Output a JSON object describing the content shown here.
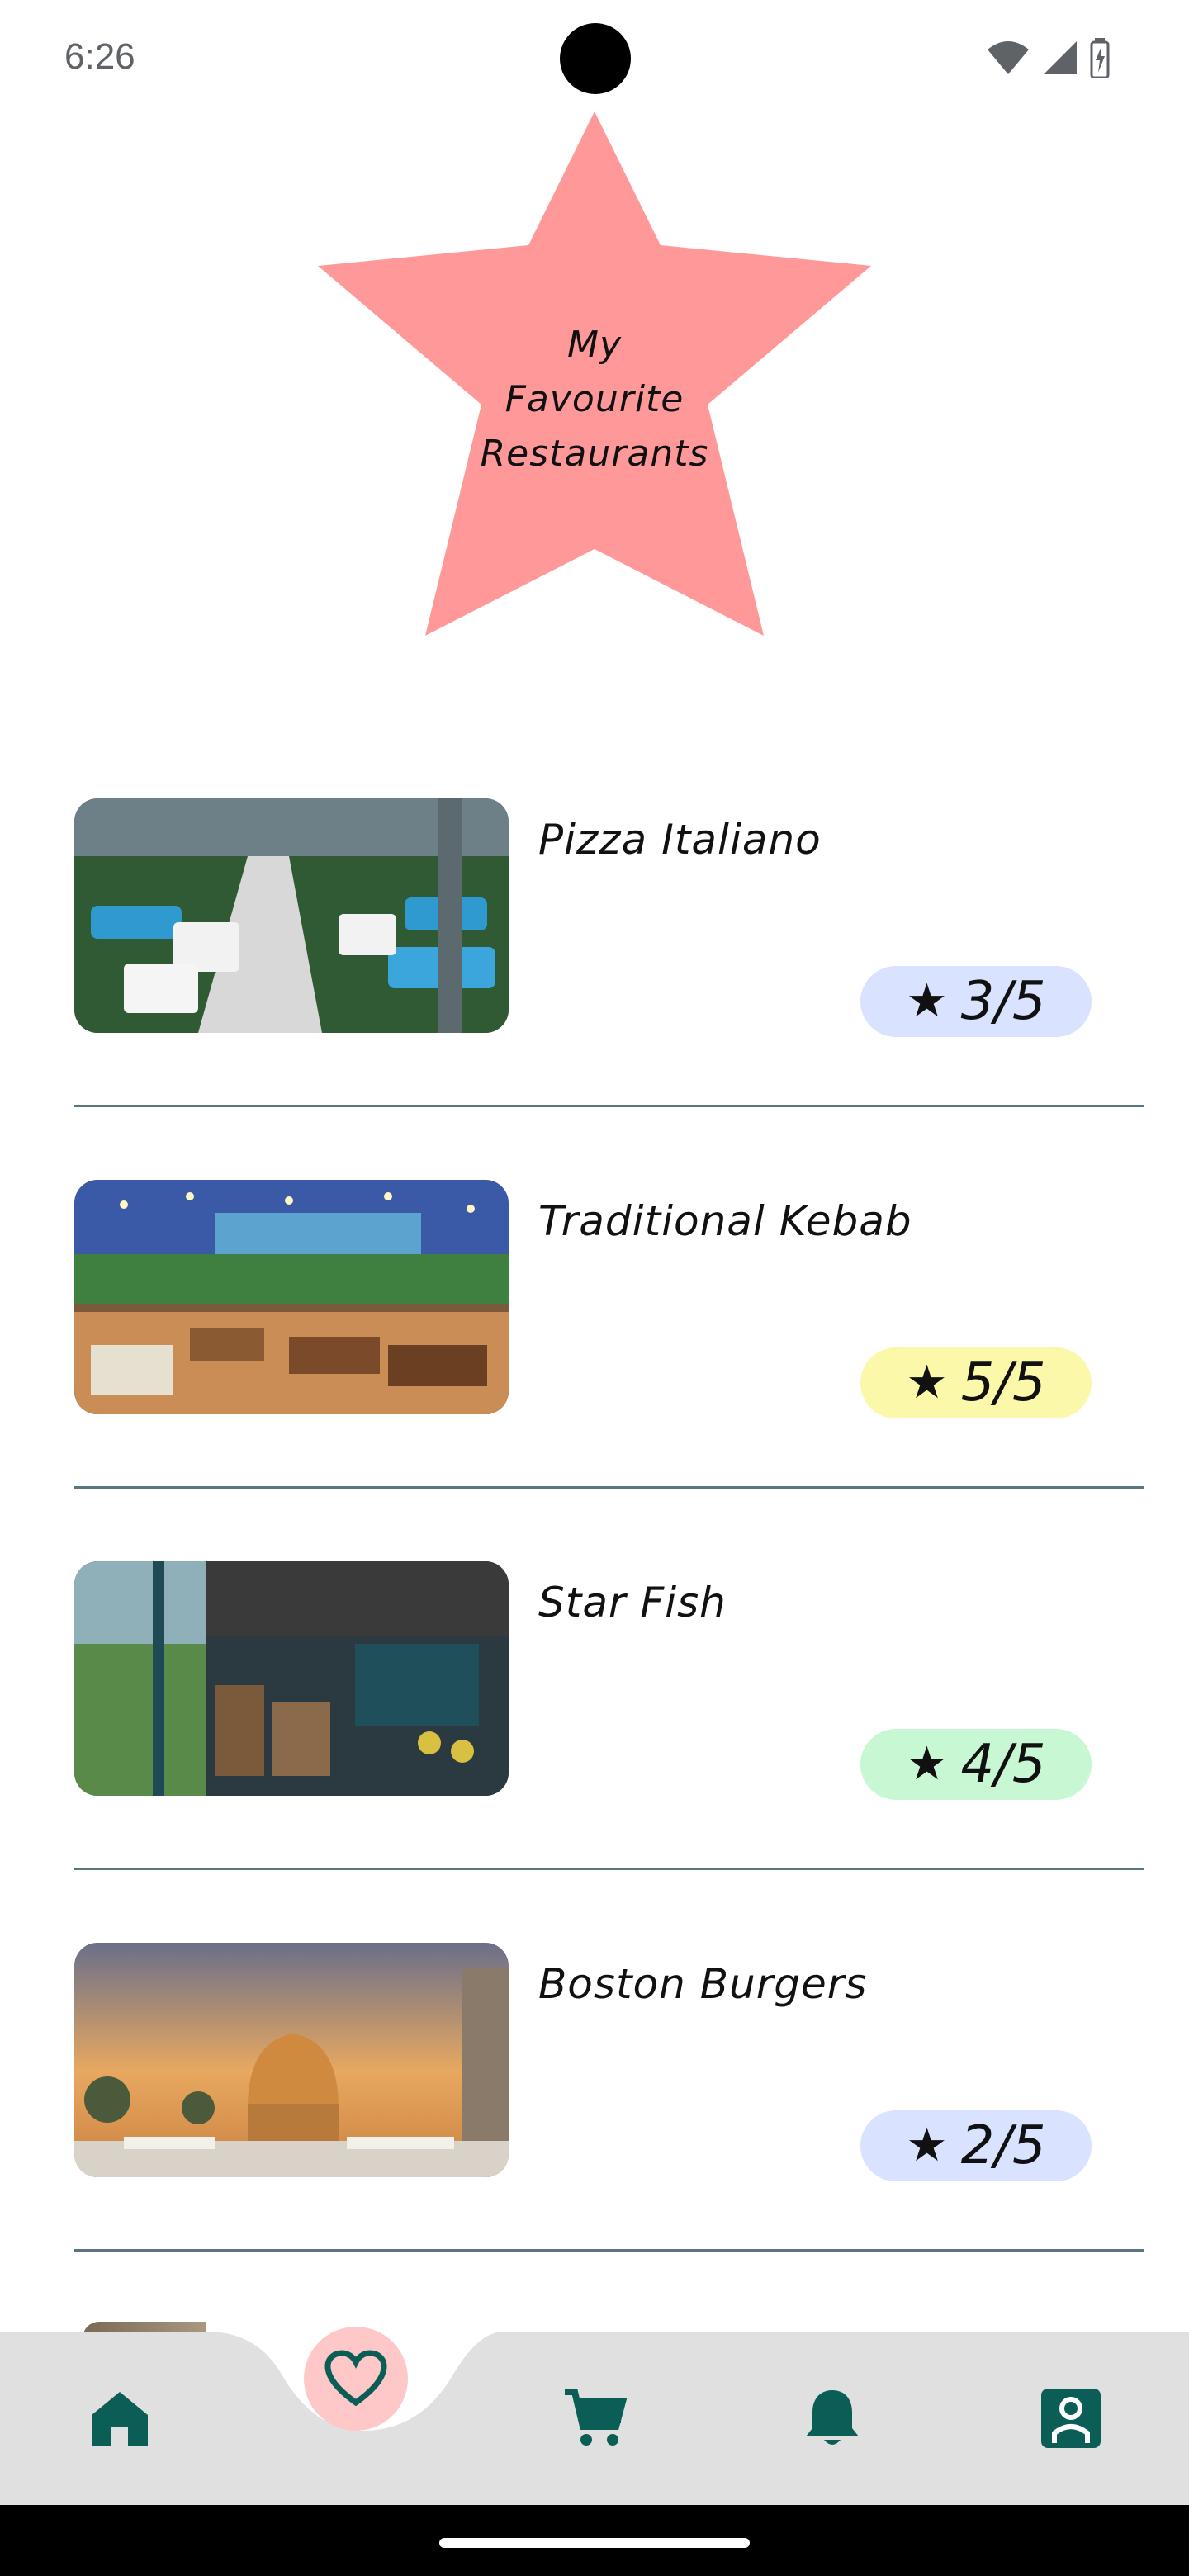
{
  "status_bar": {
    "time": "6:26"
  },
  "header": {
    "title_lines": [
      "My",
      "Favourite",
      "Restaurants"
    ],
    "star_color": "#ff9999"
  },
  "restaurants": [
    {
      "name": "Pizza Italiano",
      "rating": "3/5",
      "pill_color": "#d9e2ff"
    },
    {
      "name": "Traditional Kebab",
      "rating": "5/5",
      "pill_color": "#fbf8a9"
    },
    {
      "name": "Star Fish",
      "rating": "4/5",
      "pill_color": "#c8f7d4"
    },
    {
      "name": "Boston Burgers",
      "rating": "2/5",
      "pill_color": "#d9e2ff"
    }
  ],
  "bottom_nav": {
    "items": [
      "home-icon",
      "heart-icon",
      "cart-icon",
      "bell-icon",
      "profile-icon"
    ],
    "accent_color": "#0b5e55",
    "active_bg": "#ffc8c8"
  }
}
